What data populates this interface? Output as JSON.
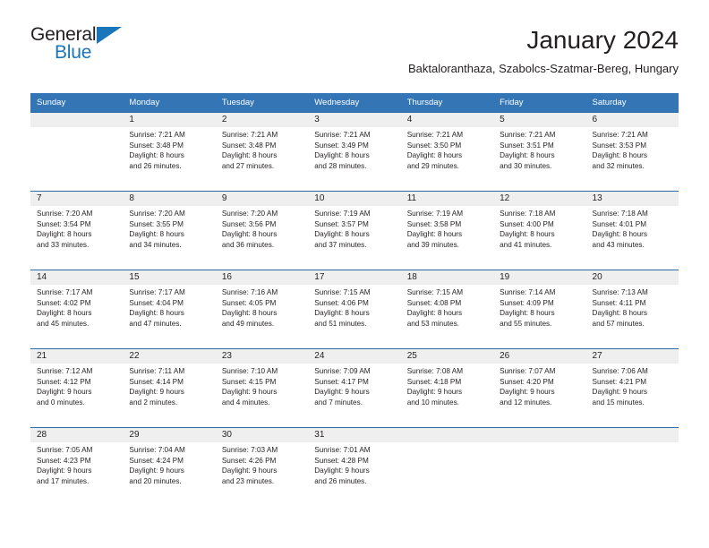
{
  "logo": {
    "word_primary": "General",
    "word_secondary": "Blue"
  },
  "header": {
    "title": "January 2024",
    "subtitle": "Baktaloranthaza, Szabolcs-Szatmar-Bereg, Hungary"
  },
  "colors": {
    "header_blue": "#3375b5",
    "row_divider_blue": "#2d6ca8",
    "daynum_band": "#efefef",
    "logo_blue": "#1b75bb",
    "text": "#231f20"
  },
  "calendar": {
    "weekday_headers": [
      "Sunday",
      "Monday",
      "Tuesday",
      "Wednesday",
      "Thursday",
      "Friday",
      "Saturday"
    ],
    "weeks": [
      [
        {
          "day": "",
          "lines": []
        },
        {
          "day": "1",
          "lines": [
            "Sunrise: 7:21 AM",
            "Sunset: 3:48 PM",
            "Daylight: 8 hours",
            "and 26 minutes."
          ]
        },
        {
          "day": "2",
          "lines": [
            "Sunrise: 7:21 AM",
            "Sunset: 3:48 PM",
            "Daylight: 8 hours",
            "and 27 minutes."
          ]
        },
        {
          "day": "3",
          "lines": [
            "Sunrise: 7:21 AM",
            "Sunset: 3:49 PM",
            "Daylight: 8 hours",
            "and 28 minutes."
          ]
        },
        {
          "day": "4",
          "lines": [
            "Sunrise: 7:21 AM",
            "Sunset: 3:50 PM",
            "Daylight: 8 hours",
            "and 29 minutes."
          ]
        },
        {
          "day": "5",
          "lines": [
            "Sunrise: 7:21 AM",
            "Sunset: 3:51 PM",
            "Daylight: 8 hours",
            "and 30 minutes."
          ]
        },
        {
          "day": "6",
          "lines": [
            "Sunrise: 7:21 AM",
            "Sunset: 3:53 PM",
            "Daylight: 8 hours",
            "and 32 minutes."
          ]
        }
      ],
      [
        {
          "day": "7",
          "lines": [
            "Sunrise: 7:20 AM",
            "Sunset: 3:54 PM",
            "Daylight: 8 hours",
            "and 33 minutes."
          ]
        },
        {
          "day": "8",
          "lines": [
            "Sunrise: 7:20 AM",
            "Sunset: 3:55 PM",
            "Daylight: 8 hours",
            "and 34 minutes."
          ]
        },
        {
          "day": "9",
          "lines": [
            "Sunrise: 7:20 AM",
            "Sunset: 3:56 PM",
            "Daylight: 8 hours",
            "and 36 minutes."
          ]
        },
        {
          "day": "10",
          "lines": [
            "Sunrise: 7:19 AM",
            "Sunset: 3:57 PM",
            "Daylight: 8 hours",
            "and 37 minutes."
          ]
        },
        {
          "day": "11",
          "lines": [
            "Sunrise: 7:19 AM",
            "Sunset: 3:58 PM",
            "Daylight: 8 hours",
            "and 39 minutes."
          ]
        },
        {
          "day": "12",
          "lines": [
            "Sunrise: 7:18 AM",
            "Sunset: 4:00 PM",
            "Daylight: 8 hours",
            "and 41 minutes."
          ]
        },
        {
          "day": "13",
          "lines": [
            "Sunrise: 7:18 AM",
            "Sunset: 4:01 PM",
            "Daylight: 8 hours",
            "and 43 minutes."
          ]
        }
      ],
      [
        {
          "day": "14",
          "lines": [
            "Sunrise: 7:17 AM",
            "Sunset: 4:02 PM",
            "Daylight: 8 hours",
            "and 45 minutes."
          ]
        },
        {
          "day": "15",
          "lines": [
            "Sunrise: 7:17 AM",
            "Sunset: 4:04 PM",
            "Daylight: 8 hours",
            "and 47 minutes."
          ]
        },
        {
          "day": "16",
          "lines": [
            "Sunrise: 7:16 AM",
            "Sunset: 4:05 PM",
            "Daylight: 8 hours",
            "and 49 minutes."
          ]
        },
        {
          "day": "17",
          "lines": [
            "Sunrise: 7:15 AM",
            "Sunset: 4:06 PM",
            "Daylight: 8 hours",
            "and 51 minutes."
          ]
        },
        {
          "day": "18",
          "lines": [
            "Sunrise: 7:15 AM",
            "Sunset: 4:08 PM",
            "Daylight: 8 hours",
            "and 53 minutes."
          ]
        },
        {
          "day": "19",
          "lines": [
            "Sunrise: 7:14 AM",
            "Sunset: 4:09 PM",
            "Daylight: 8 hours",
            "and 55 minutes."
          ]
        },
        {
          "day": "20",
          "lines": [
            "Sunrise: 7:13 AM",
            "Sunset: 4:11 PM",
            "Daylight: 8 hours",
            "and 57 minutes."
          ]
        }
      ],
      [
        {
          "day": "21",
          "lines": [
            "Sunrise: 7:12 AM",
            "Sunset: 4:12 PM",
            "Daylight: 9 hours",
            "and 0 minutes."
          ]
        },
        {
          "day": "22",
          "lines": [
            "Sunrise: 7:11 AM",
            "Sunset: 4:14 PM",
            "Daylight: 9 hours",
            "and 2 minutes."
          ]
        },
        {
          "day": "23",
          "lines": [
            "Sunrise: 7:10 AM",
            "Sunset: 4:15 PM",
            "Daylight: 9 hours",
            "and 4 minutes."
          ]
        },
        {
          "day": "24",
          "lines": [
            "Sunrise: 7:09 AM",
            "Sunset: 4:17 PM",
            "Daylight: 9 hours",
            "and 7 minutes."
          ]
        },
        {
          "day": "25",
          "lines": [
            "Sunrise: 7:08 AM",
            "Sunset: 4:18 PM",
            "Daylight: 9 hours",
            "and 10 minutes."
          ]
        },
        {
          "day": "26",
          "lines": [
            "Sunrise: 7:07 AM",
            "Sunset: 4:20 PM",
            "Daylight: 9 hours",
            "and 12 minutes."
          ]
        },
        {
          "day": "27",
          "lines": [
            "Sunrise: 7:06 AM",
            "Sunset: 4:21 PM",
            "Daylight: 9 hours",
            "and 15 minutes."
          ]
        }
      ],
      [
        {
          "day": "28",
          "lines": [
            "Sunrise: 7:05 AM",
            "Sunset: 4:23 PM",
            "Daylight: 9 hours",
            "and 17 minutes."
          ]
        },
        {
          "day": "29",
          "lines": [
            "Sunrise: 7:04 AM",
            "Sunset: 4:24 PM",
            "Daylight: 9 hours",
            "and 20 minutes."
          ]
        },
        {
          "day": "30",
          "lines": [
            "Sunrise: 7:03 AM",
            "Sunset: 4:26 PM",
            "Daylight: 9 hours",
            "and 23 minutes."
          ]
        },
        {
          "day": "31",
          "lines": [
            "Sunrise: 7:01 AM",
            "Sunset: 4:28 PM",
            "Daylight: 9 hours",
            "and 26 minutes."
          ]
        },
        {
          "day": "",
          "lines": []
        },
        {
          "day": "",
          "lines": []
        },
        {
          "day": "",
          "lines": []
        }
      ]
    ]
  }
}
